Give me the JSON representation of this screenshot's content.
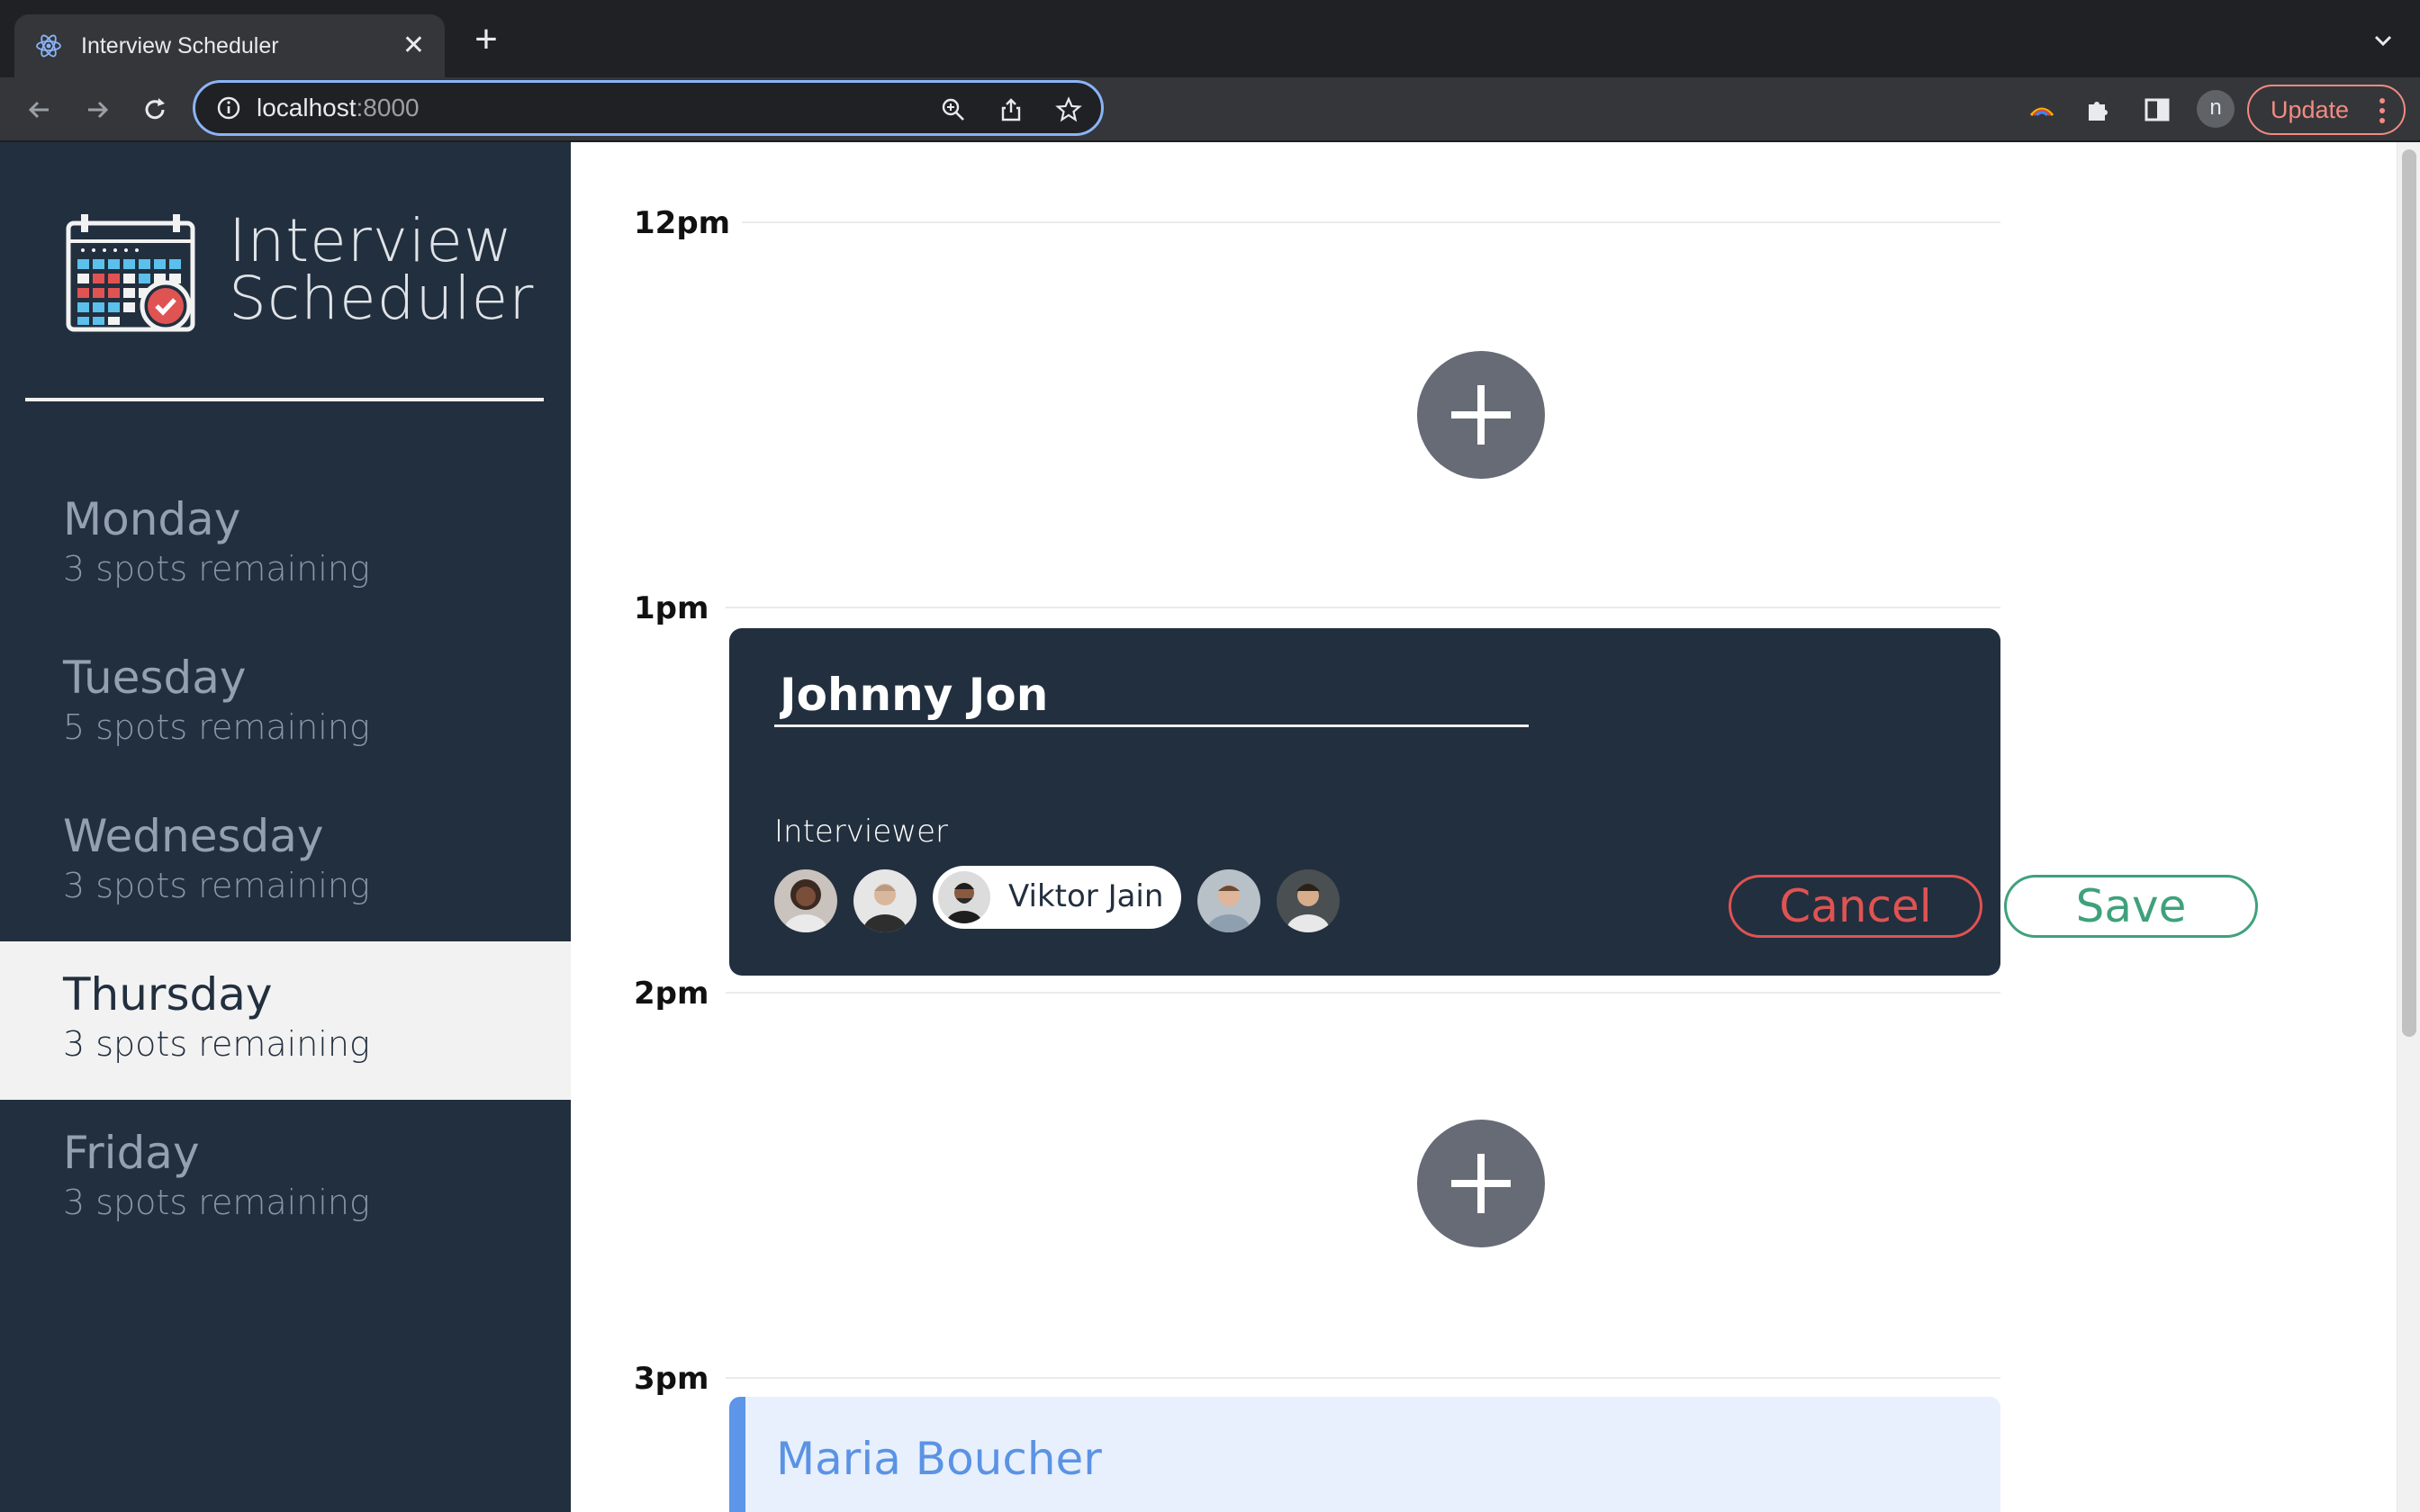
{
  "browser": {
    "tab_title": "Interview Scheduler",
    "url_host": "localhost",
    "url_port": ":8000",
    "profile_initial": "n",
    "update_label": "Update"
  },
  "app": {
    "title_line1": "Interview",
    "title_line2": "Scheduler"
  },
  "days": [
    {
      "name": "Monday",
      "spots": "3 spots remaining",
      "selected": false
    },
    {
      "name": "Tuesday",
      "spots": "5 spots remaining",
      "selected": false
    },
    {
      "name": "Wednesday",
      "spots": "3 spots remaining",
      "selected": false
    },
    {
      "name": "Thursday",
      "spots": "3 spots remaining",
      "selected": true
    },
    {
      "name": "Friday",
      "spots": "3 spots remaining",
      "selected": false
    }
  ],
  "schedule": {
    "times": [
      "12pm",
      "1pm",
      "2pm",
      "3pm"
    ]
  },
  "form": {
    "student_name": "Johnny Jon",
    "interviewer_label": "Interviewer",
    "selected_interviewer": "Viktor Jain",
    "cancel_label": "Cancel",
    "save_label": "Save"
  },
  "booked": {
    "student_name": "Maria Boucher"
  },
  "colors": {
    "sidebar_bg": "#222f3e",
    "cancel": "#e05353",
    "save": "#3fa17b",
    "booked_accent": "#5d95e8"
  }
}
